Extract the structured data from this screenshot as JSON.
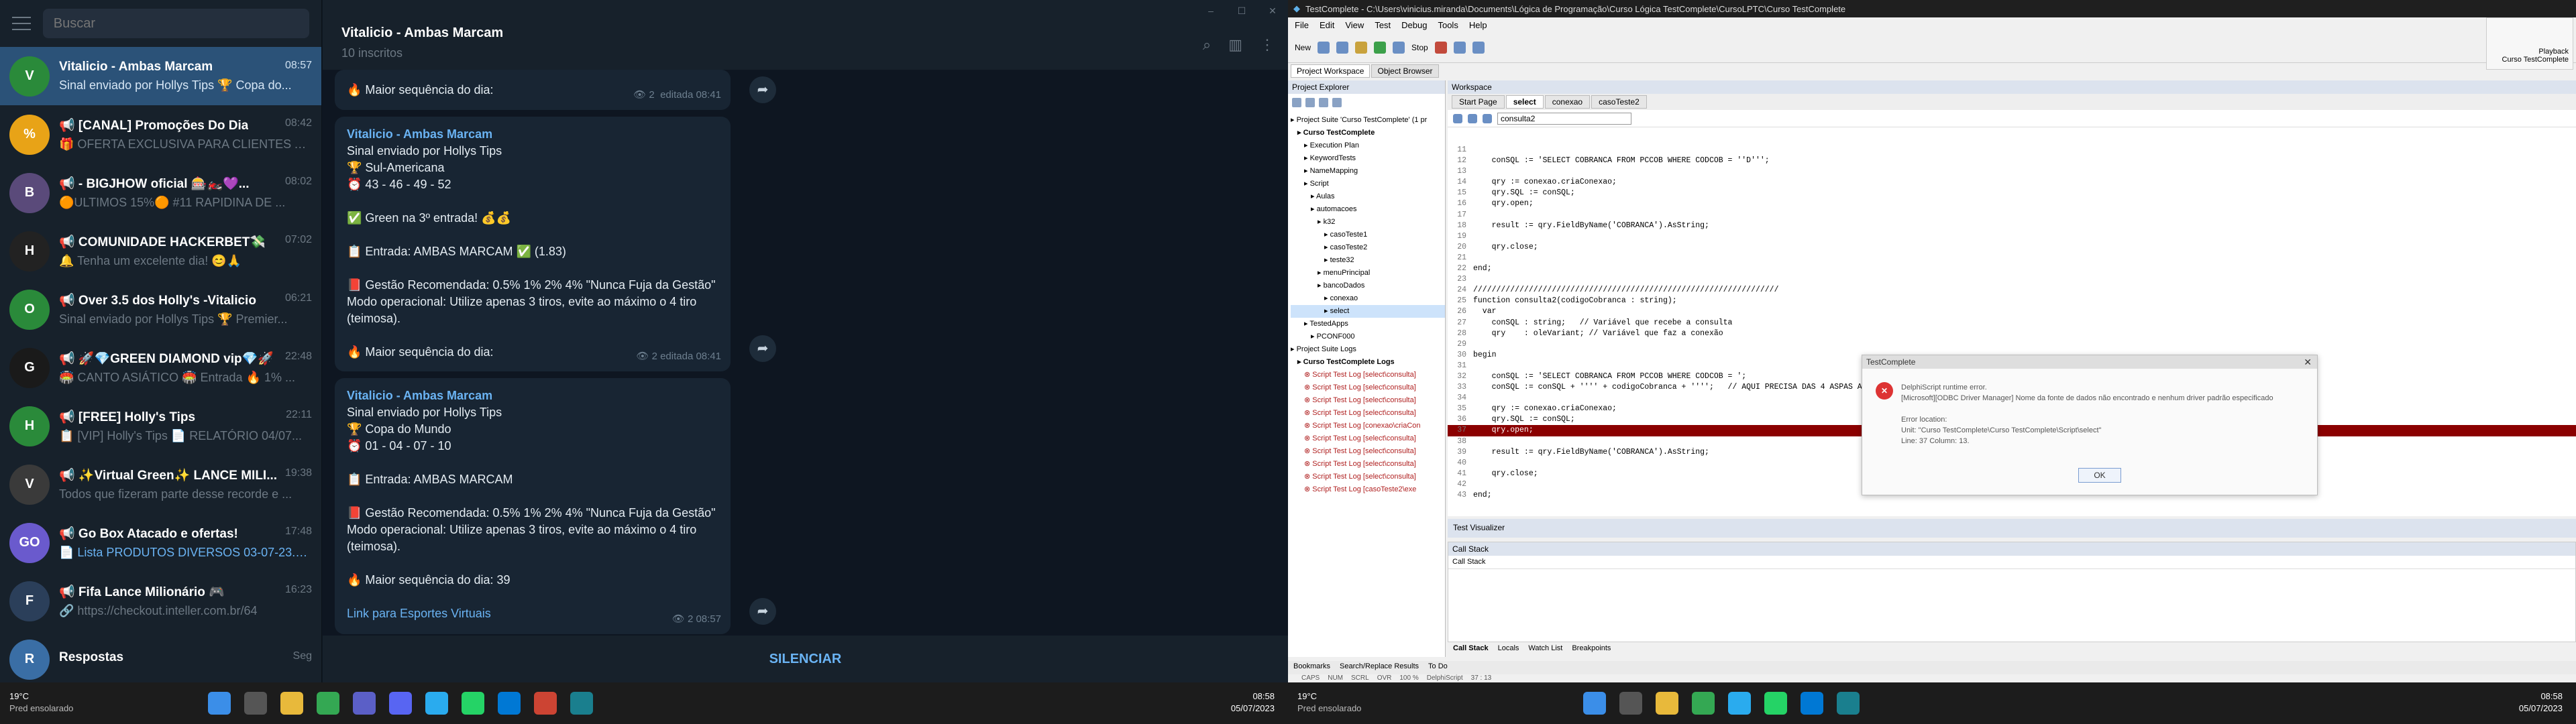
{
  "telegram": {
    "search_placeholder": "Buscar",
    "window_controls": [
      "–",
      "☐",
      "✕"
    ],
    "chats": [
      {
        "name": "Vitalicio - Ambas Marcam",
        "time": "08:57",
        "preview": "Sinal enviado por Hollys Tips 🏆 Copa do...",
        "color": "#2a8a3a",
        "initials": "V",
        "selected": true
      },
      {
        "name": "📢 [CANAL] Promoções Do Dia",
        "time": "08:42",
        "preview": "🎁 OFERTA EXCLUSIVA PARA CLIENTES AM...",
        "color": "#e8a317",
        "initials": "%"
      },
      {
        "name": "📢 - BIGJHOW oficial 🎰🏍️💜...",
        "time": "08:02",
        "preview": "🟠ULTIMOS 15%🟠 #11 RAPIDINA DE ...",
        "color": "#5a4a7a",
        "initials": "B"
      },
      {
        "name": "📢 COMUNIDADE HACKERBET💸",
        "time": "07:02",
        "preview": "🔔 Tenha um excelente dia! 😊🙏",
        "color": "#222222",
        "initials": "H"
      },
      {
        "name": "📢 Over 3.5 dos Holly's -Vitalicio",
        "time": "06:21",
        "preview": "Sinal enviado por Hollys Tips 🏆 Premier...",
        "color": "#2a8a3a",
        "initials": "O"
      },
      {
        "name": "📢 🚀💎GREEN DIAMOND vip💎🚀",
        "time": "22:48",
        "preview": "🏟️ CANTO ASIÁTICO 🏟️ Entrada 🔥 1% ...",
        "color": "#1a1a1a",
        "initials": "G"
      },
      {
        "name": "📢 [FREE] Holly's Tips",
        "time": "22:11",
        "preview": "📋 [VIP] Holly's Tips 📄 RELATÓRIO 04/07...",
        "color": "#2a8a3a",
        "initials": "H"
      },
      {
        "name": "📢 ✨Virtual Green✨ LANCE MILI...",
        "time": "19:38",
        "preview": "Todos que fizeram parte desse recorde e ...",
        "color": "#3a3a3a",
        "initials": "V"
      },
      {
        "name": "📢 Go Box Atacado e ofertas!",
        "time": "17:48",
        "preview": "📄 Lista PRODUTOS DIVERSOS 03-07-23.pdf",
        "color": "#6a5acd",
        "initials": "GO",
        "link": true
      },
      {
        "name": "📢 Fifa Lance Milionário 🎮",
        "time": "16:23",
        "preview": "🔗 https://checkout.inteller.com.br/64",
        "color": "#2b3f5a",
        "initials": "F"
      },
      {
        "name": "Respostas",
        "time": "Seg",
        "preview": "",
        "color": "#3a6ea5",
        "initials": "R"
      }
    ],
    "header": {
      "title": "Vitalicio - Ambas Marcam",
      "subtitle": "10 inscritos"
    },
    "messages": [
      {
        "top_text": "🔥 Maior sequência do dia:",
        "views": "2",
        "time": "editada 08:41"
      },
      {
        "author": "Vitalicio - Ambas Marcam",
        "sender": "Sinal enviado por Hollys Tips",
        "lines": [
          "🏆 Sul-Americana",
          "⏰ 43 - 46 - 49 - 52",
          "",
          "✅ Green na 3º entrada! 💰💰",
          "",
          "📋 Entrada: AMBAS MARCAM ✅ (1.83)",
          "",
          "📕 Gestão Recomendada: 0.5% 1% 2% 4% \"Nunca Fuja da Gestão\"",
          "Modo operacional: Utilize apenas 3 tiros, evite ao máximo o 4 tiro",
          "(teimosa).",
          "",
          "🔥 Maior sequência do dia:"
        ],
        "views": "2",
        "time": "editada 08:41"
      },
      {
        "author": "Vitalicio - Ambas Marcam",
        "sender": "Sinal enviado por Hollys Tips",
        "lines": [
          "🏆 Copa do Mundo",
          "⏰ 01 - 04 - 07 - 10",
          "",
          "📋 Entrada: AMBAS MARCAM",
          "",
          "📕 Gestão Recomendada: 0.5% 1% 2% 4% \"Nunca Fuja da Gestão\"",
          "Modo operacional: Utilize apenas 3 tiros, evite ao máximo o 4 tiro",
          "(teimosa).",
          "",
          "🔥 Maior sequência do dia: 39",
          "",
          "Link para Esportes Virtuais"
        ],
        "views": "2",
        "time": "08:57"
      }
    ],
    "mute_label": "SILENCIAR"
  },
  "testcomplete": {
    "title": "TestComplete - C:\\Users\\vinicius.miranda\\Documents\\Lógica de Programação\\Curso Lógica TestComplete\\CursoLPTC\\Curso TestComplete",
    "menu": [
      "File",
      "Edit",
      "View",
      "Test",
      "Debug",
      "Tools",
      "Help"
    ],
    "toolbar_new": "New",
    "toolbar_stop": "Stop",
    "left_tabs": [
      "Project Workspace",
      "Object Browser"
    ],
    "explorer_title": "Project Explorer",
    "tree": [
      "Project Suite 'Curso TestComplete' (1 pr",
      "Curso TestComplete",
      "Execution Plan",
      "KeywordTests",
      "NameMapping",
      "Script",
      "Aulas",
      "automacoes",
      "k32",
      "casoTeste1",
      "casoTeste2",
      "teste32",
      "menuPrincipal",
      "bancoDados",
      "conexao",
      "select",
      "TestedApps",
      "PCONF000",
      "Project Suite Logs",
      "Curso TestComplete Logs",
      "Script Test Log [select\\consulta]",
      "Script Test Log [select\\consulta]",
      "Script Test Log [select\\consulta]",
      "Script Test Log [select\\consulta]",
      "Script Test Log [conexao\\criaCon",
      "Script Test Log [select\\consulta]",
      "Script Test Log [select\\consulta]",
      "Script Test Log [select\\consulta]",
      "Script Test Log [select\\consulta]",
      "Script Test Log [casoTeste2\\exe"
    ],
    "explorer_bottom": [
      "Bookmarks",
      "Search/Replace Results",
      "To Do"
    ],
    "workspace_title": "Workspace",
    "workspace_tabs": [
      "Start Page",
      "select",
      "conexao",
      "casoTeste2"
    ],
    "routine": "consulta2",
    "code": [
      {
        "n": "11",
        "t": ""
      },
      {
        "n": "12",
        "t": "    conSQL := 'SELECT COBRANCA FROM PCCOB WHERE CODCOB = ''D''';"
      },
      {
        "n": "13",
        "t": ""
      },
      {
        "n": "14",
        "t": "    qry := conexao.criaConexao;"
      },
      {
        "n": "15",
        "t": "    qry.SQL := conSQL;"
      },
      {
        "n": "16",
        "t": "    qry.open;"
      },
      {
        "n": "17",
        "t": ""
      },
      {
        "n": "18",
        "t": "    result := qry.FieldByName('COBRANCA').AsString;"
      },
      {
        "n": "19",
        "t": ""
      },
      {
        "n": "20",
        "t": "    qry.close;"
      },
      {
        "n": "21",
        "t": ""
      },
      {
        "n": "22",
        "t": "end;"
      },
      {
        "n": "23",
        "t": ""
      },
      {
        "n": "24",
        "t": "//////////////////////////////////////////////////////////////////"
      },
      {
        "n": "25",
        "t": "function consulta2(codigoCobranca : string);"
      },
      {
        "n": "26",
        "t": "  var"
      },
      {
        "n": "27",
        "t": "    conSQL : string;   // Variável que recebe a consulta"
      },
      {
        "n": "28",
        "t": "    qry    : oleVariant; // Variável que faz a conexão"
      },
      {
        "n": "29",
        "t": ""
      },
      {
        "n": "30",
        "t": "begin"
      },
      {
        "n": "31",
        "t": ""
      },
      {
        "n": "32",
        "t": "    conSQL := 'SELECT COBRANCA FROM PCCOB WHERE CODCOB = ';"
      },
      {
        "n": "33",
        "t": "    conSQL := conSQL + '''' + codigoCobranca + '''';   // AQUI PRECISA DAS 4 ASPAS ANTES E DEPOIS VISTO QUE O CAMPO É VARCHAR DE CODCOB"
      },
      {
        "n": "34",
        "t": ""
      },
      {
        "n": "35",
        "t": "    qry := conexao.criaConexao;"
      },
      {
        "n": "36",
        "t": "    qry.SQL := conSQL;"
      },
      {
        "n": "37",
        "t": "    qry.open;",
        "err": true
      },
      {
        "n": "38",
        "t": ""
      },
      {
        "n": "39",
        "t": "    result := qry.FieldByName('COBRANCA').AsString;"
      },
      {
        "n": "40",
        "t": ""
      },
      {
        "n": "41",
        "t": "    qry.close;"
      },
      {
        "n": "42",
        "t": ""
      },
      {
        "n": "43",
        "t": "end;"
      }
    ],
    "dialog": {
      "title": "TestComplete",
      "lines": [
        "DelphiScript runtime error.",
        "[Microsoft][ODBC Driver Manager] Nome da fonte de dados não encontrado e nenhum driver padrão especificado",
        "",
        "Error location:",
        "Unit: \"Curso TestComplete\\Curso TestComplete\\Script\\select\"",
        "Line: 37 Column: 13."
      ],
      "ok": "OK"
    },
    "visualizer": "Test Visualizer",
    "callstack_title": "Call Stack",
    "callstack_header": "Call Stack",
    "bottom_tabs": [
      "Call Stack",
      "Locals",
      "Watch List",
      "Breakpoints"
    ],
    "status": [
      "CAPS",
      "NUM",
      "SCRL",
      "OVR",
      "100 %",
      "DelphiScript",
      "37 : 13"
    ],
    "playback": [
      "Playback",
      "Curso TestComplete"
    ]
  },
  "taskbar": {
    "temp": "19°C",
    "weather": "Pred ensolarado",
    "time": "08:58",
    "date": "05/07/2023"
  }
}
